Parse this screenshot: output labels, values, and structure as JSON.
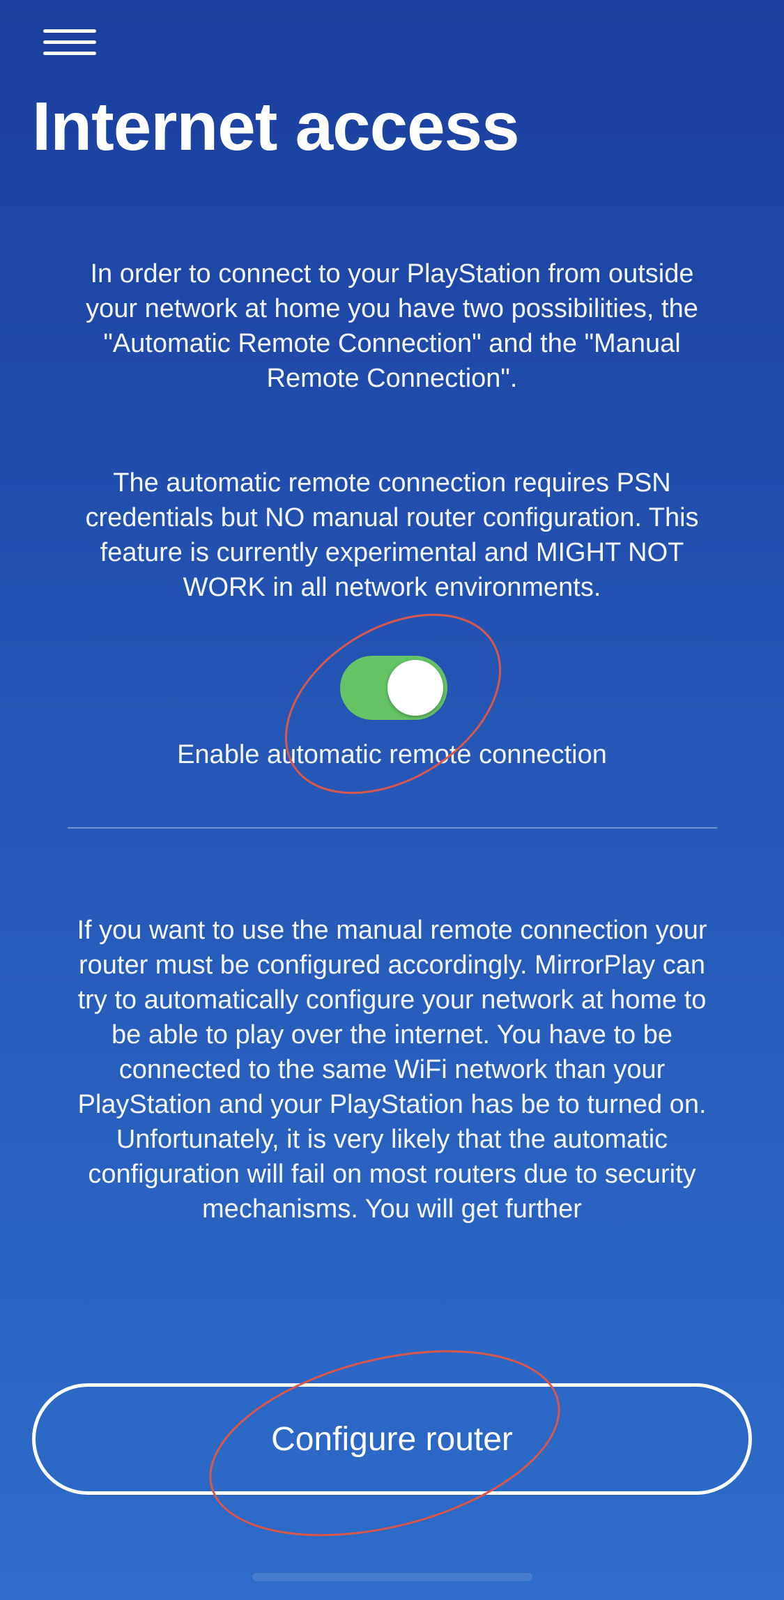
{
  "header": {
    "menu_icon": "hamburger-menu-icon",
    "title": "Internet access"
  },
  "content": {
    "intro": "In order to connect to your PlayStation from outside your network at home you have two possibilities, the \"Automatic Remote Connection\" and the \"Manual Remote Connection\".",
    "automatic_info": "The automatic remote connection requires PSN credentials but NO manual router configuration. This feature is currently experimental and MIGHT NOT WORK in all network environments.",
    "toggle": {
      "label": "Enable automatic remote connection",
      "state": "on",
      "on_color": "#65c466"
    },
    "manual_info": "If you want to use the manual remote connection your router must be configured accordingly. MirrorPlay can try to automatically configure your network at home to be able to play over the internet. You have to be connected to the same WiFi network than your PlayStation and your PlayStation has be to turned on.",
    "warning": "Unfortunately, it is very likely that the automatic configuration will fail on most routers due to security mechanisms. You will get further"
  },
  "actions": {
    "configure_router_label": "Configure router"
  },
  "colors": {
    "background_top": "#1a3f9e",
    "background_bottom": "#2d6cc9",
    "annotation_circle": "#d9574a"
  }
}
